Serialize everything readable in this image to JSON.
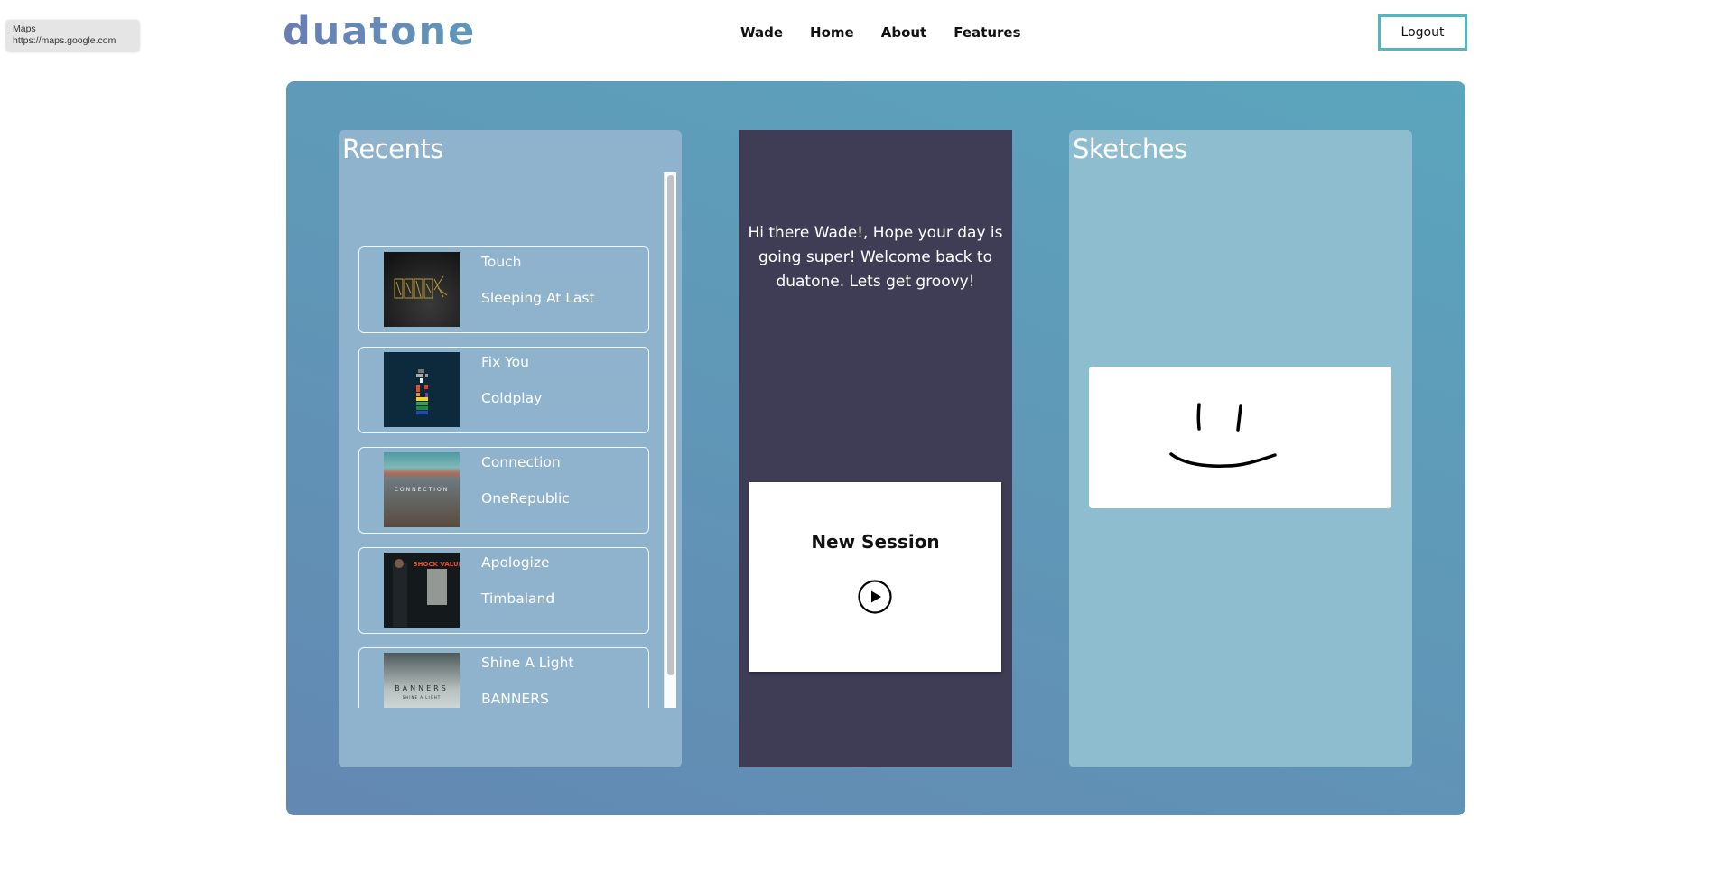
{
  "tooltip": {
    "title": "Maps",
    "url": "https://maps.google.com"
  },
  "header": {
    "logo": "duatone",
    "nav": [
      "Wade",
      "Home",
      "About",
      "Features"
    ],
    "logout_label": "Logout"
  },
  "colors": {
    "logo_start": "#6a7db5",
    "logo_end": "#5f97b9",
    "logout_border": "#4fb6c2",
    "welcome_bg": "#3f3d56",
    "recents_bg": "#8fb3cc",
    "sketches_bg": "#8fbdd0"
  },
  "recents": {
    "title": "Recents",
    "tracks": [
      {
        "title": "Touch",
        "artist": "Sleeping At Last",
        "cover_icon": "album-cover-touch"
      },
      {
        "title": "Fix You",
        "artist": "Coldplay",
        "cover_icon": "album-cover-x-and-y"
      },
      {
        "title": "Connection",
        "artist": "OneRepublic",
        "cover_icon": "album-cover-connection"
      },
      {
        "title": "Apologize",
        "artist": "Timbaland",
        "cover_icon": "album-cover-shock-value"
      },
      {
        "title": "Shine A Light",
        "artist": "BANNERS",
        "cover_icon": "album-cover-shine-a-light"
      }
    ],
    "cover_text": {
      "connection": "CONNECTION",
      "shock_value": "SHOCK VALUE",
      "banners": "BANNERS",
      "banners_sub": "SHINE A LIGHT"
    }
  },
  "welcome": {
    "message": "Hi there Wade!, Hope your day is going super! Welcome back to duatone. Lets get groovy!",
    "session_label": "New Session"
  },
  "sketches": {
    "title": "Sketches"
  }
}
